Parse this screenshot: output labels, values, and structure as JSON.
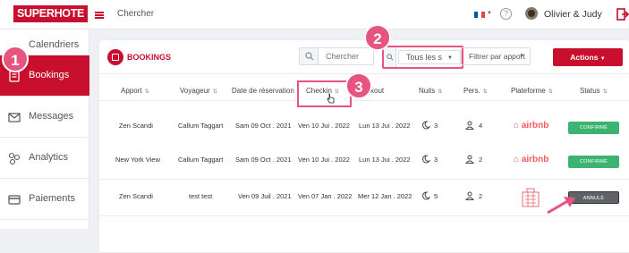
{
  "topbar": {
    "logo": "SUPERHOTE",
    "search_label": "Chercher",
    "user_name": "Olivier & Judy"
  },
  "sidebar": {
    "items": [
      {
        "label": "Calendriers",
        "icon": "calendar-icon",
        "active": false
      },
      {
        "label": "Bookings",
        "icon": "bookings-icon",
        "active": true
      },
      {
        "label": "Messages",
        "icon": "mail-icon",
        "active": false
      },
      {
        "label": "Analytics",
        "icon": "analytics-icon",
        "active": false
      },
      {
        "label": "Paiements",
        "icon": "payment-icon",
        "active": false
      }
    ]
  },
  "panel": {
    "title": "BOOKINGS",
    "search_placeholder": "Chercher",
    "filter_value": "Tous les s",
    "apport_filter": "Filtrer par apport",
    "actions_label": "Actions"
  },
  "table": {
    "columns": [
      "Apport",
      "Voyageur",
      "Date de réservation",
      "Checkin",
      "Checkout",
      "Nuits",
      "Pers.",
      "Plateforme",
      "Status"
    ],
    "checkout_visible_text": "kout",
    "rows": [
      {
        "apport": "Zen Scandi",
        "voyageur": "Callum Taggart",
        "reservation": "Sam 09 Oct . 2021",
        "checkin": "Ven 10 Jui . 2022",
        "checkout": "Lun 13 Jui . 2022",
        "nuits": "3",
        "pers": "4",
        "plateforme": "airbnb",
        "status": "CONFIRMÉ",
        "status_color": "#3cb371"
      },
      {
        "apport": "New York View",
        "voyageur": "Callum Taggart",
        "reservation": "Sam 09 Oct . 2021",
        "checkin": "Ven 10 Jui . 2022",
        "checkout": "Lun 13 Jui . 2022",
        "nuits": "3",
        "pers": "2",
        "plateforme": "airbnb",
        "status": "CONFIRMÉ",
        "status_color": "#3cb371"
      },
      {
        "apport": "Zen Scandi",
        "voyageur": "test test",
        "reservation": "Ven 09 Juil . 2021",
        "checkin": "Ven 07 Jan . 2022",
        "checkout": "Mer 12 Jan . 2022",
        "nuits": "5",
        "pers": "2",
        "plateforme": "hotel",
        "status": "ANNULÉ",
        "status_color": "#5f6368"
      }
    ]
  },
  "callouts": [
    "1",
    "2",
    "3"
  ],
  "colors": {
    "brand": "#c8102e",
    "highlight": "#e75480",
    "confirmed": "#3cb371",
    "cancelled": "#5f6368"
  }
}
